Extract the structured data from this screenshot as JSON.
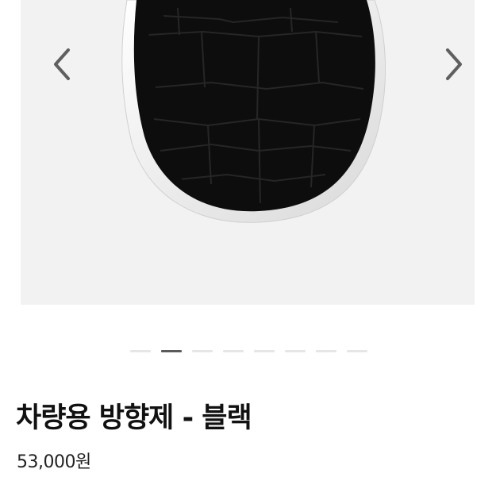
{
  "gallery": {
    "image_icon": "black-textured-oval-car-air-freshener",
    "prev_icon": "chevron-left-icon",
    "next_icon": "chevron-right-icon",
    "slide_count": 8,
    "active_slide": 2
  },
  "product": {
    "title": "차량용 방향제 - 블랙",
    "price": "53,000원"
  },
  "colors": {
    "panel_background": "#f2f2f2",
    "dot_active": "#5a5a5a",
    "dot_inactive": "#e6e6e6",
    "title_text": "#111111"
  }
}
